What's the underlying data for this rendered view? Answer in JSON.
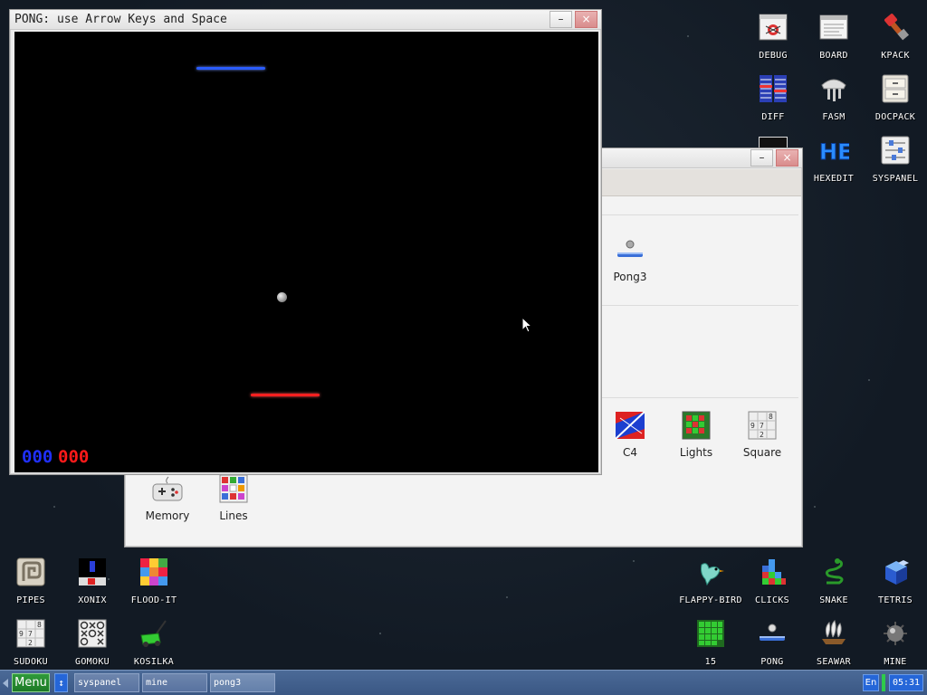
{
  "desktop_icons": {
    "debug": {
      "label": "DEBUG",
      "icon": "debug-icon"
    },
    "board": {
      "label": "BOARD",
      "icon": "board-icon"
    },
    "kpack": {
      "label": "KPACK",
      "icon": "kpack-icon"
    },
    "diff": {
      "label": "DIFF",
      "icon": "diff-icon"
    },
    "fasm": {
      "label": "FASM",
      "icon": "fasm-icon"
    },
    "docpack": {
      "label": "DOCPACK",
      "icon": "docpack-icon"
    },
    "hexedit": {
      "label": "HEXEDIT",
      "icon": "hexedit-icon"
    },
    "syspanel": {
      "label": "SYSPANEL",
      "icon": "syspanel-icon"
    },
    "pipes": {
      "label": "PIPES",
      "icon": "pipes-icon"
    },
    "xonix": {
      "label": "XONIX",
      "icon": "xonix-icon"
    },
    "flood_it": {
      "label": "FLOOD-IT",
      "icon": "flood-it-icon"
    },
    "sudoku": {
      "label": "SUDOKU",
      "icon": "sudoku-icon"
    },
    "gomoku": {
      "label": "GOMOKU",
      "icon": "gomoku-icon"
    },
    "kosilka": {
      "label": "KOSILKA",
      "icon": "kosilka-icon"
    },
    "flappy_bird": {
      "label": "FLAPPY-BIRD",
      "icon": "flappy-bird-icon"
    },
    "clicks": {
      "label": "CLICKS",
      "icon": "clicks-icon"
    },
    "snake": {
      "label": "SNAKE",
      "icon": "snake-icon"
    },
    "tetris": {
      "label": "TETRIS",
      "icon": "tetris-icon"
    },
    "fifteen": {
      "label": "15",
      "icon": "fifteen-icon"
    },
    "pong": {
      "label": "PONG",
      "icon": "pong-icon"
    },
    "seawar": {
      "label": "SEAWAR",
      "icon": "seawar-icon"
    },
    "mine": {
      "label": "MINE",
      "icon": "mine-icon"
    }
  },
  "pong_window": {
    "title": "PONG: use Arrow Keys and Space",
    "minimize_label": "–",
    "close_label": "×",
    "score_blue": "000",
    "score_red": "000"
  },
  "launcher_window": {
    "minimize_label": "–",
    "close_label": "×",
    "apps": {
      "pong3": "Pong3",
      "c4": "C4",
      "lights": "Lights",
      "square": "Square",
      "memory": "Memory",
      "lines": "Lines"
    }
  },
  "taskbar": {
    "menu_label": "Menu",
    "toggle_label": "↕",
    "tasks": [
      "syspanel",
      "mine",
      "pong3"
    ],
    "language": "En",
    "clock": "05:31"
  },
  "colors": {
    "player_paddle": "#ff2020",
    "cpu_paddle": "#2a5cff",
    "accent": "#2566d8"
  }
}
